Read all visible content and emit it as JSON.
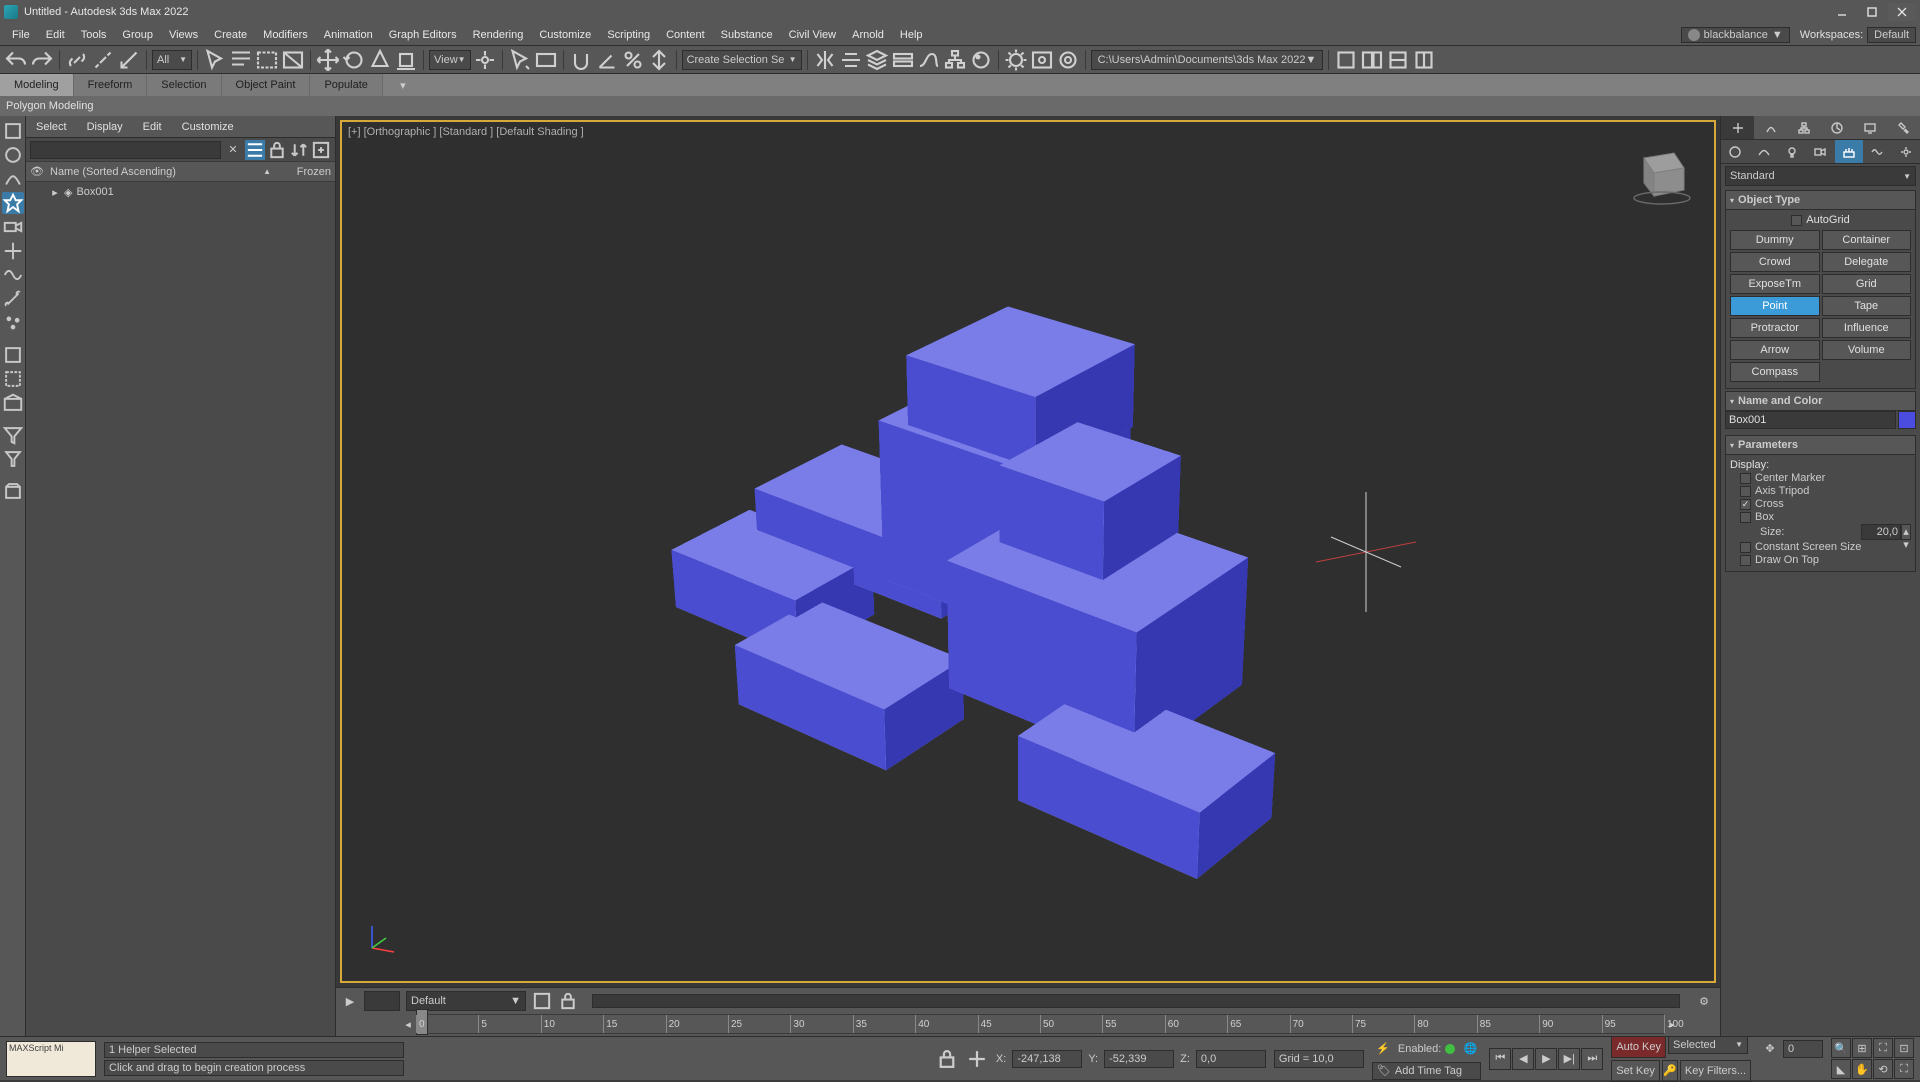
{
  "title": "Untitled - Autodesk 3ds Max 2022",
  "menus": [
    "File",
    "Edit",
    "Tools",
    "Group",
    "Views",
    "Create",
    "Modifiers",
    "Animation",
    "Graph Editors",
    "Rendering",
    "Customize",
    "Scripting",
    "Content",
    "Substance",
    "Civil View",
    "Arnold",
    "Help"
  ],
  "user": "blackbalance",
  "workspace_label": "Workspaces:",
  "workspace_value": "Default",
  "toolbar": {
    "filter_all": "All",
    "view_label": "View",
    "selset_placeholder": "Create Selection Se",
    "path": "C:\\Users\\Admin\\Documents\\3ds Max 2022"
  },
  "ribbon_tabs": [
    "Modeling",
    "Freeform",
    "Selection",
    "Object Paint",
    "Populate"
  ],
  "ribbon_panel": "Polygon Modeling",
  "scene_explorer": {
    "tabs": [
      "Select",
      "Display",
      "Edit",
      "Customize"
    ],
    "col_name": "Name (Sorted Ascending)",
    "col_frozen": "Frozen",
    "items": [
      {
        "name": "Box001"
      }
    ]
  },
  "viewport_label": "[+] [Orthographic ] [Standard ] [Default Shading ]",
  "command": {
    "category": "Standard",
    "roll_objtype": "Object Type",
    "autogrid": "AutoGrid",
    "buttons": [
      [
        "Dummy",
        "Container"
      ],
      [
        "Crowd",
        "Delegate"
      ],
      [
        "ExposeTm",
        "Grid"
      ],
      [
        "Point",
        "Tape"
      ],
      [
        "Protractor",
        "Influence"
      ],
      [
        "Arrow",
        "Volume"
      ],
      [
        "Compass",
        ""
      ]
    ],
    "active_button": "Point",
    "roll_namecolor": "Name and Color",
    "object_name": "Box001",
    "roll_params": "Parameters",
    "display_label": "Display:",
    "params": {
      "center_marker": "Center Marker",
      "axis_tripod": "Axis Tripod",
      "cross": "Cross",
      "box": "Box",
      "size_label": "Size:",
      "size_value": "20,0",
      "const_screen": "Constant Screen Size",
      "draw_on_top": "Draw On Top"
    }
  },
  "timeline": {
    "material": "Default",
    "frame_value": "0 / 100",
    "ticks": [
      0,
      5,
      10,
      15,
      20,
      25,
      30,
      35,
      40,
      45,
      50,
      55,
      60,
      65,
      70,
      75,
      80,
      85,
      90,
      95,
      100
    ]
  },
  "status": {
    "maxscript": "MAXScript Mi",
    "sel": "1 Helper Selected",
    "prompt": "Click and drag to begin creation process",
    "x_label": "X:",
    "x_val": "-247,138",
    "y_label": "Y:",
    "y_val": "-52,339",
    "z_label": "Z:",
    "z_val": "0,0",
    "grid": "Grid = 10,0",
    "enabled": "Enabled:",
    "addtag": "Add Time Tag",
    "autokey": "Auto Key",
    "selected": "Selected",
    "setkey": "Set Key",
    "keyfilters": "Key Filters...",
    "frame": "0"
  }
}
